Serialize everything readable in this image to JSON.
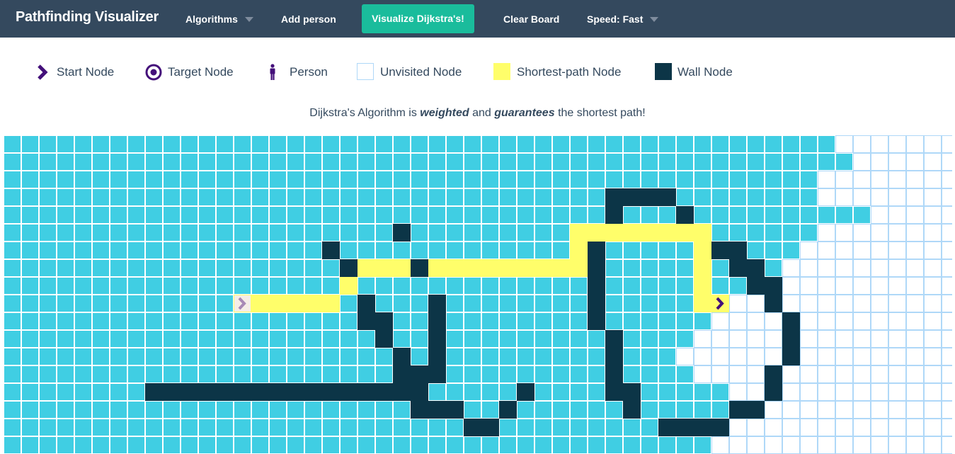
{
  "navbar": {
    "brand": "Pathfinding Visualizer",
    "algorithms_label": "Algorithms",
    "add_person_label": "Add person",
    "visualize_label": "Visualize Dijkstra's!",
    "clear_board_label": "Clear Board",
    "speed_label": "Speed: Fast"
  },
  "legend": {
    "start": "Start Node",
    "target": "Target Node",
    "person": "Person",
    "unvisited": "Unvisited Node",
    "shortest_path": "Shortest-path Node",
    "wall": "Wall Node"
  },
  "description": {
    "prefix": "Dijkstra's Algorithm is",
    "emphasis1": "weighted",
    "middle": "and",
    "emphasis2": "guarantees",
    "suffix": "the shortest path!"
  },
  "colors": {
    "navbar": "#34495e",
    "accent": "#1abc9c",
    "visited": "#40cee3",
    "wall": "#0c3547",
    "shortest_path": "#fffe6a",
    "unvisited_border": "#afd8f8",
    "node_icon": "#44107a",
    "start_node_faded": "#a889b6"
  },
  "icons": {
    "start": "chevron-right-icon",
    "target": "target-circle-icon",
    "person": "person-icon"
  },
  "grid": {
    "rows": 18,
    "cols": 54,
    "start": [
      9,
      13
    ],
    "end": [
      9,
      40
    ],
    "visited_until_col": [
      46,
      47,
      45,
      45,
      48,
      45,
      44,
      43,
      42,
      40,
      39,
      38,
      37,
      38,
      40,
      41,
      40,
      39
    ],
    "walls": [
      [
        3,
        34
      ],
      [
        3,
        35
      ],
      [
        3,
        36
      ],
      [
        3,
        37
      ],
      [
        4,
        34
      ],
      [
        4,
        38
      ],
      [
        5,
        22
      ],
      [
        6,
        18
      ],
      [
        6,
        33
      ],
      [
        6,
        40
      ],
      [
        6,
        41
      ],
      [
        7,
        19
      ],
      [
        7,
        23
      ],
      [
        7,
        33
      ],
      [
        7,
        41
      ],
      [
        7,
        42
      ],
      [
        8,
        33
      ],
      [
        8,
        42
      ],
      [
        8,
        43
      ],
      [
        9,
        20
      ],
      [
        9,
        24
      ],
      [
        9,
        33
      ],
      [
        9,
        43
      ],
      [
        10,
        20
      ],
      [
        10,
        21
      ],
      [
        10,
        24
      ],
      [
        10,
        33
      ],
      [
        10,
        44
      ],
      [
        11,
        21
      ],
      [
        11,
        24
      ],
      [
        11,
        34
      ],
      [
        11,
        44
      ],
      [
        12,
        22
      ],
      [
        12,
        24
      ],
      [
        12,
        34
      ],
      [
        12,
        44
      ],
      [
        13,
        22
      ],
      [
        13,
        23
      ],
      [
        13,
        24
      ],
      [
        13,
        34
      ],
      [
        13,
        43
      ],
      [
        14,
        8
      ],
      [
        14,
        9
      ],
      [
        14,
        10
      ],
      [
        14,
        11
      ],
      [
        14,
        12
      ],
      [
        14,
        13
      ],
      [
        14,
        14
      ],
      [
        14,
        15
      ],
      [
        14,
        16
      ],
      [
        14,
        17
      ],
      [
        14,
        18
      ],
      [
        14,
        19
      ],
      [
        14,
        20
      ],
      [
        14,
        21
      ],
      [
        14,
        22
      ],
      [
        14,
        23
      ],
      [
        14,
        29
      ],
      [
        14,
        34
      ],
      [
        14,
        35
      ],
      [
        14,
        43
      ],
      [
        15,
        23
      ],
      [
        15,
        24
      ],
      [
        15,
        25
      ],
      [
        15,
        28
      ],
      [
        15,
        35
      ],
      [
        15,
        41
      ],
      [
        15,
        42
      ],
      [
        16,
        26
      ],
      [
        16,
        27
      ],
      [
        16,
        37
      ],
      [
        16,
        38
      ],
      [
        16,
        39
      ],
      [
        16,
        40
      ]
    ],
    "path": [
      [
        9,
        14
      ],
      [
        9,
        15
      ],
      [
        9,
        16
      ],
      [
        9,
        17
      ],
      [
        9,
        18
      ],
      [
        8,
        19
      ],
      [
        7,
        19
      ],
      [
        7,
        20
      ],
      [
        7,
        21
      ],
      [
        7,
        22
      ],
      [
        7,
        23
      ],
      [
        7,
        24
      ],
      [
        7,
        25
      ],
      [
        7,
        26
      ],
      [
        7,
        27
      ],
      [
        7,
        28
      ],
      [
        7,
        29
      ],
      [
        7,
        30
      ],
      [
        7,
        31
      ],
      [
        7,
        32
      ],
      [
        6,
        32
      ],
      [
        5,
        32
      ],
      [
        5,
        33
      ],
      [
        5,
        34
      ],
      [
        5,
        35
      ],
      [
        5,
        36
      ],
      [
        5,
        37
      ],
      [
        5,
        38
      ],
      [
        5,
        39
      ],
      [
        6,
        39
      ],
      [
        7,
        39
      ],
      [
        8,
        39
      ],
      [
        9,
        39
      ]
    ]
  }
}
